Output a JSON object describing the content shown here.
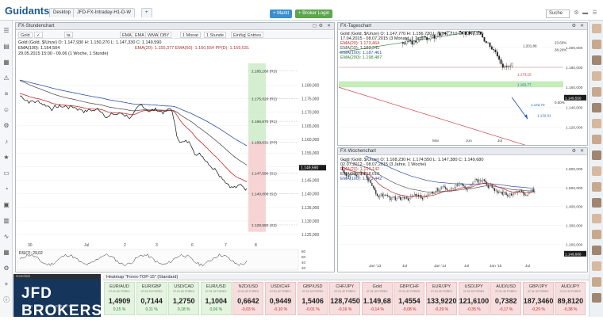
{
  "app": {
    "logo": "Guidants",
    "logo_sub": "",
    "tabs": [
      "Desktop",
      "JFD-FX-Intraday-H1-D-W",
      "+"
    ],
    "buttons": {
      "market": "+ Markt",
      "broker": "+ Broker Login",
      "search": "Suche"
    }
  },
  "colors": {
    "accent": "#3a8fd0",
    "brand": "#16355a",
    "up": "#2e7d32",
    "down": "#c62828"
  },
  "left_icons": [
    "menu-icon",
    "chart-icon",
    "news-icon",
    "alert-icon",
    "layers-icon",
    "user-icon",
    "settings-icon",
    "bell-icon",
    "star-icon",
    "monitor-icon",
    "gauge-icon",
    "screen-icon",
    "table-icon",
    "pulse-icon",
    "grid-icon",
    "settings-icon-2",
    "plus-icon",
    "info-icon"
  ],
  "main_chart": {
    "header": "FX-Stundenchart",
    "toolbar": [
      "Gold",
      "✓",
      "ta",
      "EMA",
      "EMA",
      "WMA",
      "DBY",
      "1 Monat",
      "1 Stunde",
      "Einfüg",
      "Entries"
    ],
    "legend": [
      "Gold (Gold, $/Unze)  O: 1.147,930  H: 1.150,270  L: 1.147,330  C: 1.149,590",
      "EMA(100): 1.164,504",
      "29.05.2015 15:00 - 09.06 (1 Woche, 1 Stunde)",
      "EMA(20): 1.155,377   EMA(50): 1.160,554   PP(D): 1.159,031"
    ],
    "pivot_labels": [
      "1.185,160 (R3)",
      "1.175,020 (R2)",
      "1.166,670 (R1)",
      "1.159,031 (PP)",
      "1.147,590 (S1)",
      "1.140,000 (S2)",
      "1.128,550 (S3)"
    ],
    "y_ticks": [
      "1.180,000",
      "1.175,000",
      "1.170,000",
      "1.165,000",
      "1.160,000",
      "1.155,000",
      "1.150,000",
      "1.145,000",
      "1.140,000",
      "1.135,000",
      "1.130,000",
      "1.125,000"
    ],
    "last_price": "1.149,590",
    "x_ticks": [
      "30",
      "Jul",
      "2",
      "3",
      "6",
      "7",
      "8"
    ],
    "rsi_label": "RSI(7): 29,02",
    "rsi_ticks": [
      "80",
      "60",
      "40",
      "20"
    ]
  },
  "day_chart": {
    "header": "FX-Tageschart",
    "legend": [
      "Gold (Gold, $/Unze)  O: 1.147,770  H: 1.156,730  L: 1.147,210  C: 1.149,550",
      "17.04.2015 - 08.07.2015 (3 Monate, 1 Tag)",
      "EMA(20): 1.173,464",
      "EMA(50): 1.183,345",
      "EMA(100): 1.187,461",
      "EMA(200): 1.198,487"
    ],
    "annotations": [
      "1.173,15",
      "1.162,77",
      "1.142,73",
      "1.132,01",
      "1.201,88",
      "0.00%",
      "23.60%",
      "38.20%"
    ],
    "y_ticks": [
      "1.200,000",
      "1.180,000",
      "1.160,000",
      "1.140,000",
      "1.120,000"
    ],
    "last_price": "1.149,550",
    "x_ticks": [
      "Mai",
      "Jun",
      "Jul"
    ]
  },
  "week_chart": {
    "header": "FX-Wochenchart",
    "legend": [
      "Gold (Gold, $/Unze)  O: 1.168,230  H: 1.174,550  L: 1.147,380  C: 1.149,680",
      "02.07.2012 - 08.07.2015 (3 Jahre, 1 Woche)",
      "EMA(20): 1.193,142",
      "EMA(50): 1.218,010",
      "EMA(100): 1.273,442"
    ],
    "y_ticks": [
      "1.600,000",
      "1.500,000",
      "1.400,000",
      "1.300,000",
      "1.200,000"
    ],
    "last_price": "1.149,680",
    "x_ticks": [
      "Jan '13",
      "Jul",
      "Jan '14",
      "Jul",
      "Jan '15",
      "Jul"
    ]
  },
  "bottom": {
    "jfd_head": "Gescheit",
    "jfd_title": "JFD BROKERS",
    "jfd_sub": "GIVE FAIR AND DIRECT",
    "heatmap_title": "Heatmap \"Forex-TOP-15\" (Standard)",
    "tiles": [
      {
        "name": "EUR/AUD",
        "sub": "07.01.32 FOREX",
        "value": "1,4909",
        "change": "0,15 %",
        "neg": false
      },
      {
        "name": "EUR/GBP",
        "sub": "07.01.32 FOREX",
        "value": "0,7144",
        "change": "0,11 %",
        "neg": false
      },
      {
        "name": "USD/CAD",
        "sub": "07.01.32 FOREX",
        "value": "1,2750",
        "change": "0,18 %",
        "neg": false
      },
      {
        "name": "EUR/USD",
        "sub": "07.01.32 FOREX",
        "value": "1,1004",
        "change": "0,06 %",
        "neg": false
      },
      {
        "name": "NZD/USD",
        "sub": "07.01.32 FOREX",
        "value": "0,6642",
        "change": "-0,03 %",
        "neg": true
      },
      {
        "name": "USD/CHF",
        "sub": "07.01.32 FOREX",
        "value": "0,9449",
        "change": "-0,10 %",
        "neg": true
      },
      {
        "name": "GBP/USD",
        "sub": "07.01.32 FOREX",
        "value": "1,5406",
        "change": "-0,01 %",
        "neg": true
      },
      {
        "name": "CHF/JPY",
        "sub": "07.01.32 FOREX",
        "value": "128,7450",
        "change": "-0,16 %",
        "neg": true
      },
      {
        "name": "Gold",
        "sub": "07.01.32 FOREX",
        "value": "1.149,68",
        "change": "-0,14 %",
        "neg": true
      },
      {
        "name": "GBP/CHF",
        "sub": "07.01.32 FOREX",
        "value": "1,4554",
        "change": "-0,08 %",
        "neg": true
      },
      {
        "name": "EUR/JPY",
        "sub": "07.01.32 FOREX",
        "value": "133,9220",
        "change": "-0,29 %",
        "neg": true
      },
      {
        "name": "USD/JPY",
        "sub": "07.01.32 FOREX",
        "value": "121,6100",
        "change": "-0,35 %",
        "neg": true
      },
      {
        "name": "AUD/USD",
        "sub": "07.01.32 FOREX",
        "value": "0,7382",
        "change": "-0,17 %",
        "neg": true
      },
      {
        "name": "GBP/JPY",
        "sub": "07.01.32 FOREX",
        "value": "187,3460",
        "change": "-0,29 %",
        "neg": true
      },
      {
        "name": "AUD/JPY",
        "sub": "07.01.32 FOREX",
        "value": "89,8120",
        "change": "-0,38 %",
        "neg": true
      }
    ]
  }
}
